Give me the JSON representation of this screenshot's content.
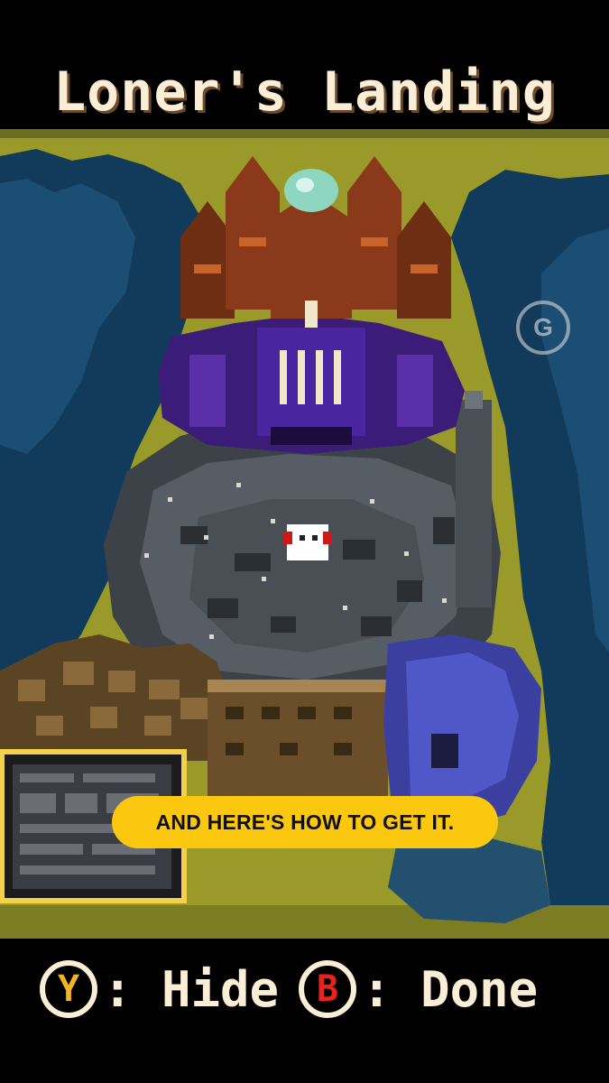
{
  "title": "Loner's Landing",
  "caption": "AND HERE'S HOW TO GET IT.",
  "watermark": "G",
  "controls": {
    "hide_button": "Y",
    "hide_label": ": Hide",
    "done_button": "B",
    "done_label": ": Done"
  },
  "colors": {
    "ground": "#9a9a2a",
    "water": "#123a5a",
    "stone": "#4a4f56",
    "purple": "#5a2fa8",
    "rust": "#8a3a1a",
    "selection": "#f2d24a",
    "caption_bg": "#fcc80f",
    "text": "#fbeed6"
  },
  "icons": [
    "y-button-icon",
    "b-button-icon",
    "watermark-logo-icon",
    "player-marker-icon"
  ]
}
